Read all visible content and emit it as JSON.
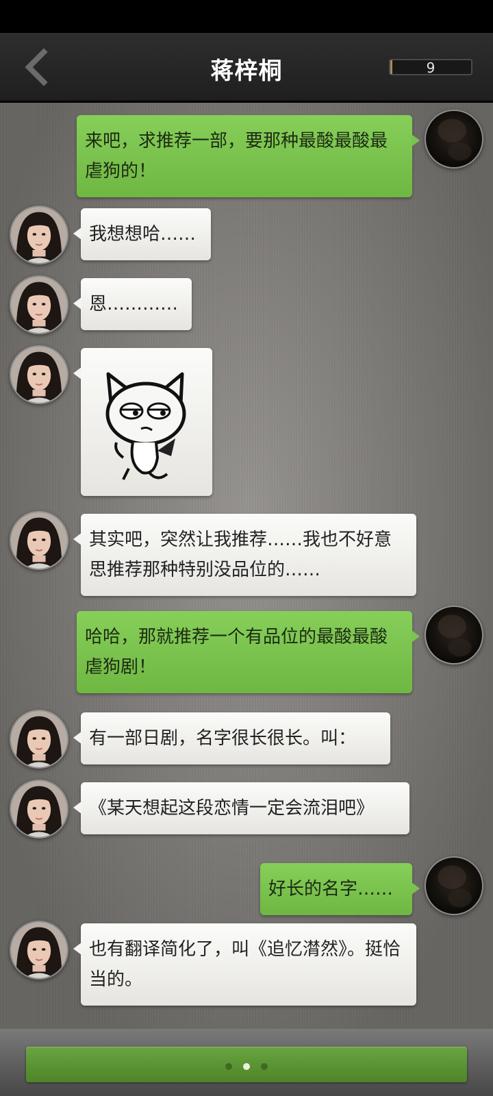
{
  "header": {
    "title": "蒋梓桐",
    "counter_value": "9",
    "back_icon": "chevron-left-icon"
  },
  "messages": [
    {
      "side": "right",
      "text": "来吧，求推荐一部，要那种最酸最酸最虐狗的！",
      "avatar": "user-avatar"
    },
    {
      "side": "left",
      "text": "我想想哈……",
      "avatar": "contact-avatar"
    },
    {
      "side": "left",
      "text": "恩…………",
      "avatar": "contact-avatar"
    },
    {
      "side": "left",
      "sticker": "devil-cat-sticker",
      "avatar": "contact-avatar"
    },
    {
      "side": "left",
      "text": "其实吧，突然让我推荐……我也不好意思推荐那种特别没品位的……",
      "avatar": "contact-avatar"
    },
    {
      "side": "right",
      "text": "哈哈，那就推荐一个有品位的最酸最酸虐狗剧！",
      "avatar": "user-avatar"
    },
    {
      "side": "left",
      "text": "有一部日剧，名字很长很长。叫：",
      "avatar": "contact-avatar"
    },
    {
      "side": "left",
      "text": "《某天想起这段恋情一定会流泪吧》",
      "avatar": "contact-avatar"
    },
    {
      "side": "right",
      "text": "好长的名字……",
      "avatar": "user-avatar"
    },
    {
      "side": "left",
      "text": "也有翻译简化了，叫《追忆潸然》。挺恰当的。",
      "avatar": "contact-avatar"
    }
  ],
  "footer": {
    "typing_indicator": "three-dots-icon",
    "active_dot": 2
  },
  "colors": {
    "header_bg": "#262626",
    "chat_bg": "#8a8783",
    "bubble_in": "#f4f4f1",
    "bubble_out": "#7cc24e",
    "input_bar": "#5c9834"
  }
}
